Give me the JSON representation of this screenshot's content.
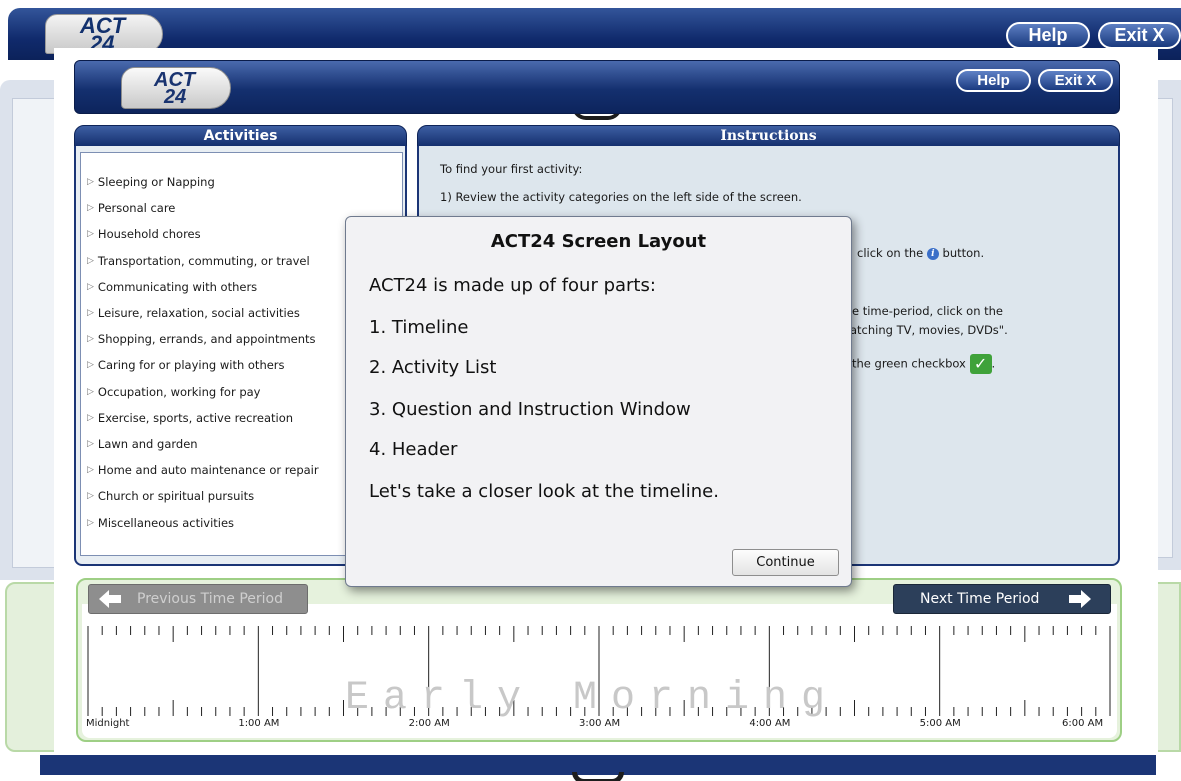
{
  "outer": {
    "logo_line1": "ACT",
    "logo_line2": "24",
    "help_label": "Help",
    "exit_label": "Exit X"
  },
  "header": {
    "logo_line1": "ACT",
    "logo_line2": "24",
    "help_label": "Help",
    "exit_label": "Exit X"
  },
  "activities": {
    "title": "Activities",
    "items": [
      "Sleeping or Napping",
      "Personal care",
      "Household chores",
      "Transportation, commuting, or travel",
      "Communicating with others",
      "Leisure, relaxation, social activities",
      "Shopping, errands, and appointments",
      "Caring for or playing with others",
      "Occupation, working for pay",
      "Exercise, sports, active recreation",
      "Lawn and garden",
      "Home and auto maintenance or repair",
      "Church or spiritual pursuits",
      "Miscellaneous activities"
    ]
  },
  "instructions": {
    "title": "Instructions",
    "line1": "To find your first activity:",
    "line2": "1) Review the activity categories on the left side of the screen.",
    "line3_tail": ".",
    "line4_tail_a": "click on the",
    "line4_tail_b": "button.",
    "line5_tail": "e time-period, click on the",
    "line6_tail": "atching TV, movies, DVDs\".",
    "line7_tail_a": "the green checkbox",
    "line7_tail_b": "."
  },
  "modal": {
    "title": "ACT24 Screen Layout",
    "intro": "ACT24 is made up of four parts:",
    "items": [
      "1. Timeline",
      "2. Activity List",
      "3. Question and Instruction Window",
      "4. Header"
    ],
    "closing": "Let's take a closer look at the timeline.",
    "continue_label": "Continue"
  },
  "timeline": {
    "prev_label": "Previous Time Period",
    "next_label": "Next Time Period",
    "period_label": "Early Morning",
    "hours": [
      "Midnight",
      "1:00 AM",
      "2:00 AM",
      "3:00 AM",
      "4:00 AM",
      "5:00 AM",
      "6:00 AM"
    ]
  },
  "colors": {
    "header_blue": "#14306f",
    "timeline_green": "#e6f2dd",
    "checkbox_green": "#3fa23a"
  },
  "icons": [
    "info-icon",
    "green-check-icon",
    "left-arrow-icon",
    "right-arrow-icon",
    "expand-triangle-icon"
  ]
}
